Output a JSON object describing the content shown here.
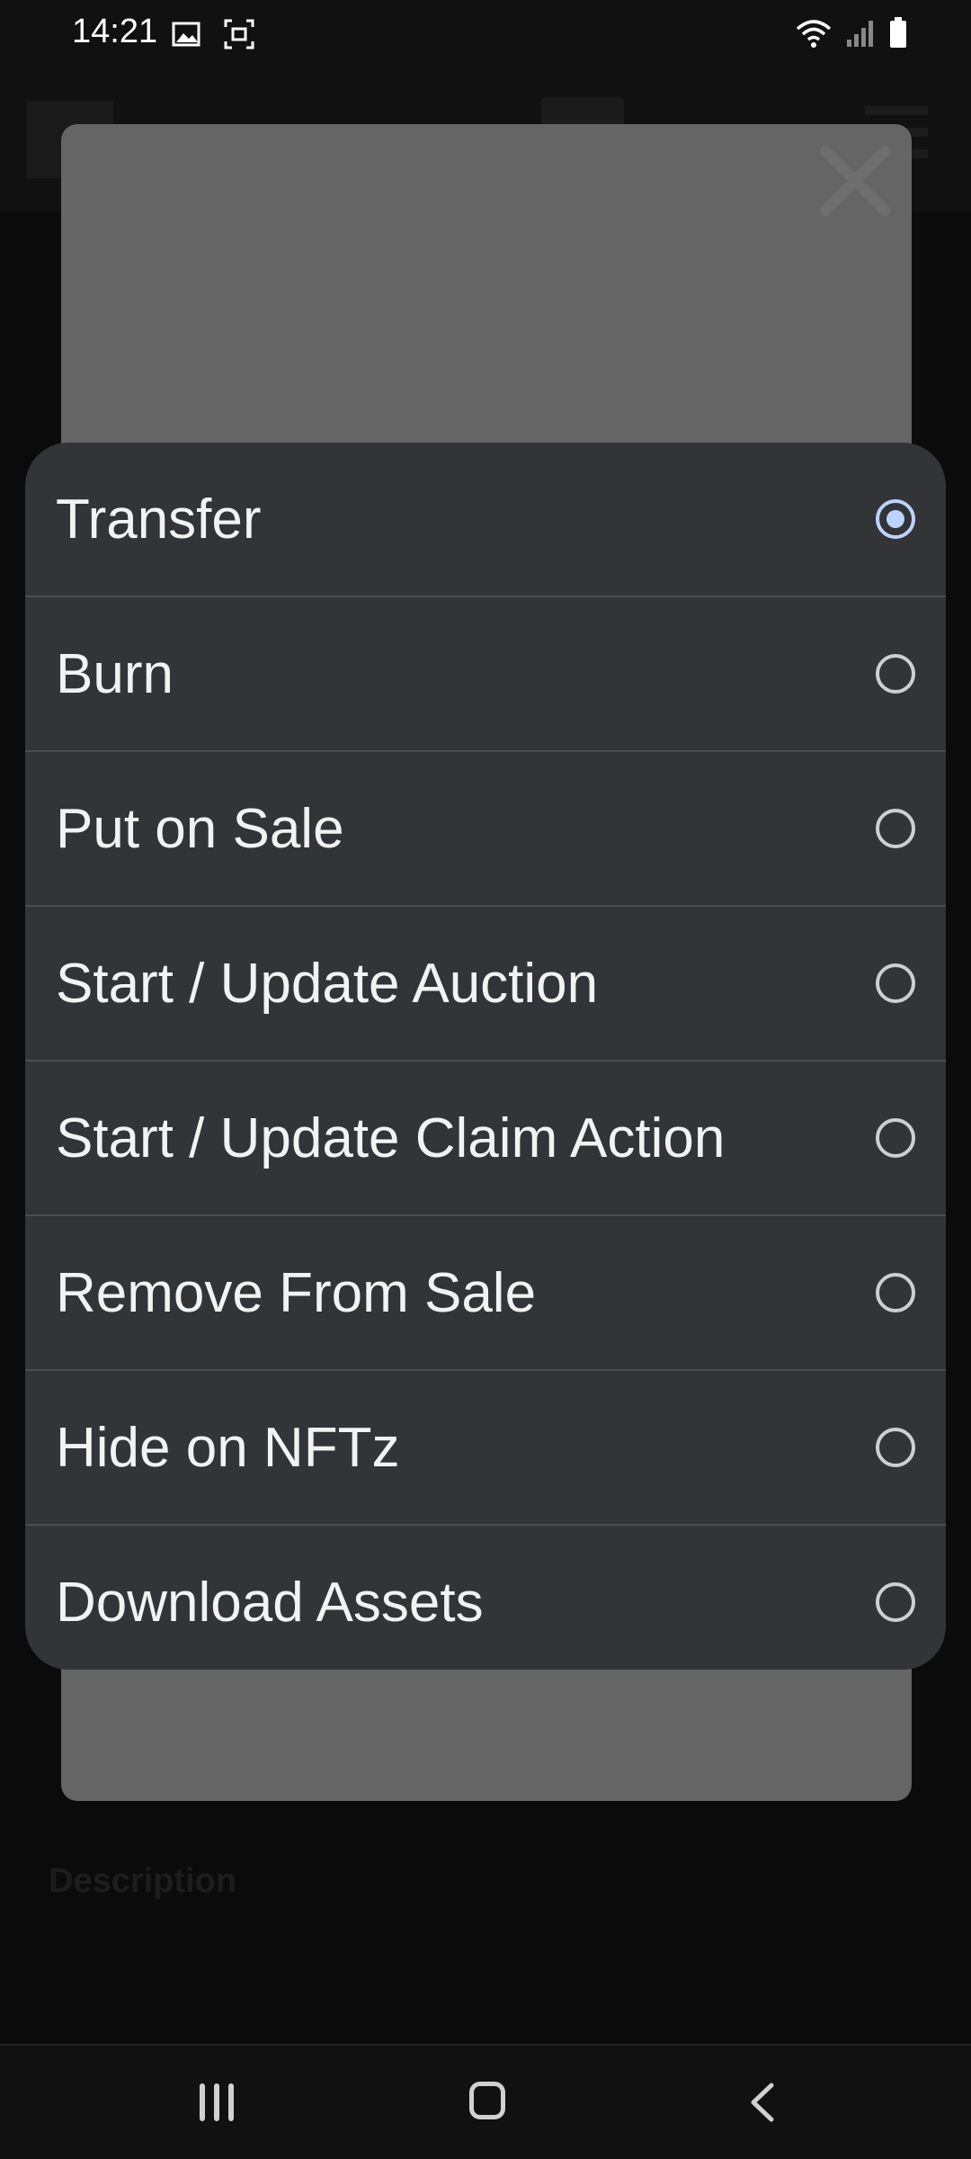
{
  "status_bar": {
    "time": "14:21",
    "left_icons": [
      "gallery-icon",
      "screen-capture-icon"
    ],
    "right_icons": [
      "wifi-icon",
      "signal-icon",
      "battery-icon"
    ]
  },
  "background": {
    "description_heading": "Description"
  },
  "modal": {
    "close_icon": "close-icon"
  },
  "options": [
    {
      "label": "Transfer",
      "selected": true
    },
    {
      "label": "Burn",
      "selected": false
    },
    {
      "label": "Put on Sale",
      "selected": false
    },
    {
      "label": "Start / Update Auction",
      "selected": false
    },
    {
      "label": "Start / Update Claim Action",
      "selected": false
    },
    {
      "label": "Remove From Sale",
      "selected": false
    },
    {
      "label": "Hide on NFTz",
      "selected": false
    },
    {
      "label": "Download Assets",
      "selected": false
    }
  ],
  "nav": {
    "recents_icon": "recents-icon",
    "home_icon": "home-icon",
    "back_icon": "back-icon"
  },
  "colors": {
    "sheet_bg": "#333437",
    "radio_selected": "#bcd3ff"
  }
}
